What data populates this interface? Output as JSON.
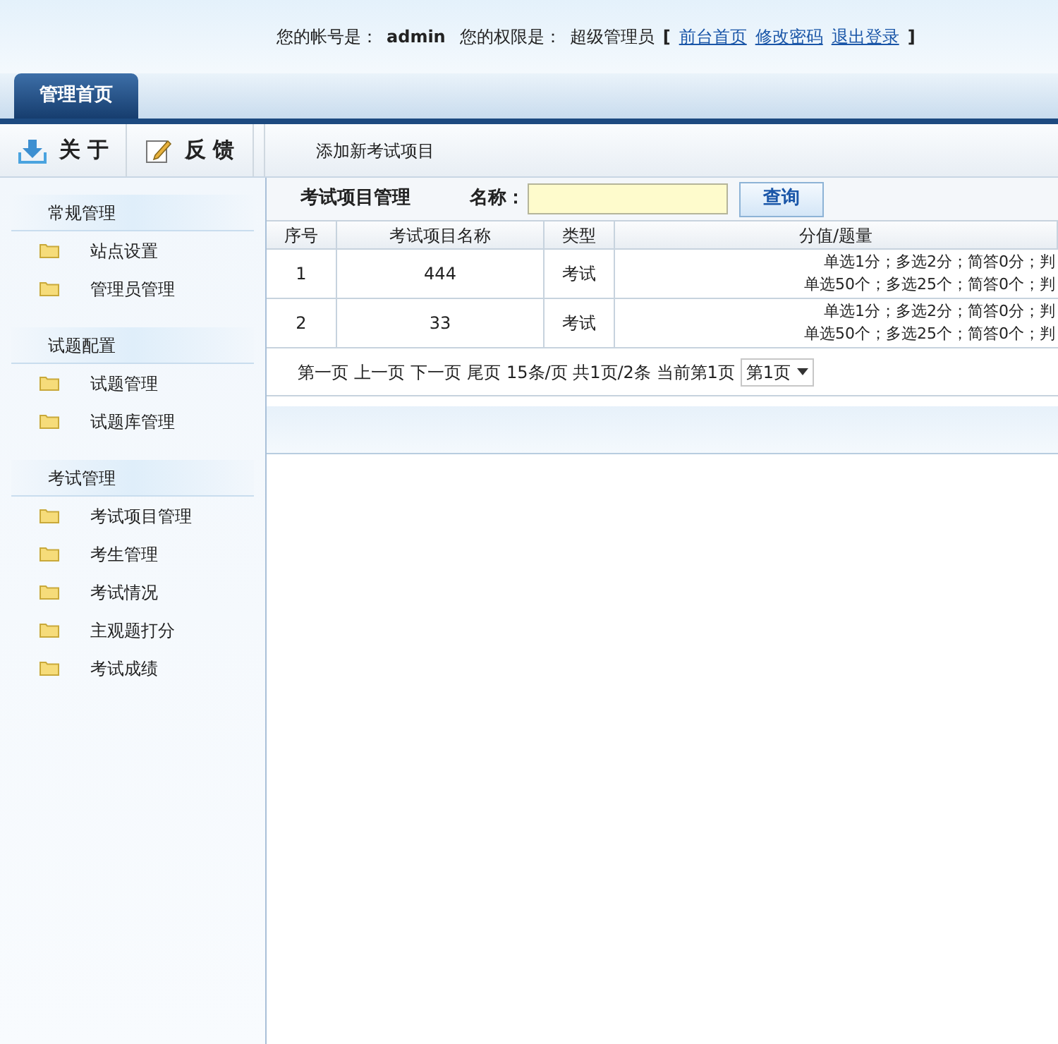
{
  "header": {
    "account_label": "您的帐号是：",
    "account": "admin",
    "role_label": "您的权限是：",
    "role": "超级管理员",
    "bracket_open": "[",
    "links": [
      "前台首页",
      "修改密码",
      "退出登录"
    ],
    "bracket_close": "]"
  },
  "tabs": [
    {
      "label": "管理首页",
      "selected": true
    }
  ],
  "toolbar": {
    "buttons": [
      {
        "label": "关 于",
        "kind": "download"
      },
      {
        "label": "反 馈",
        "kind": "edit"
      }
    ],
    "action_link": "添加新考试项目"
  },
  "sidebar": {
    "groups": [
      {
        "title": "常规管理",
        "items": [
          "站点设置",
          "管理员管理"
        ]
      },
      {
        "title": "试题配置",
        "items": [
          "试题管理",
          "试题库管理"
        ]
      },
      {
        "title": "考试管理",
        "items": [
          "考试项目管理",
          "考生管理",
          "考试情况",
          "主观题打分",
          "考试成绩"
        ]
      }
    ]
  },
  "search": {
    "title": "考试项目管理",
    "label": "名称：",
    "button": "查询"
  },
  "table": {
    "columns": [
      "序号",
      "考试项目名称",
      "类型",
      "分值/题量"
    ],
    "rows": [
      {
        "index": "1",
        "name": "444",
        "type": "考试",
        "score_lines": [
          "单选1分；多选2分；简答0分；判",
          "单选50个；多选25个；简答0个；判"
        ]
      },
      {
        "index": "2",
        "name": "33",
        "type": "考试",
        "score_lines": [
          "单选1分；多选2分；简答0分；判",
          "单选50个；多选25个；简答0个；判"
        ]
      }
    ]
  },
  "pagination": {
    "links": [
      "第一页",
      "上一页",
      "下一页",
      "尾页"
    ],
    "info": "15条/页 共1页/2条 当前第1页",
    "page_select": "第1页"
  }
}
